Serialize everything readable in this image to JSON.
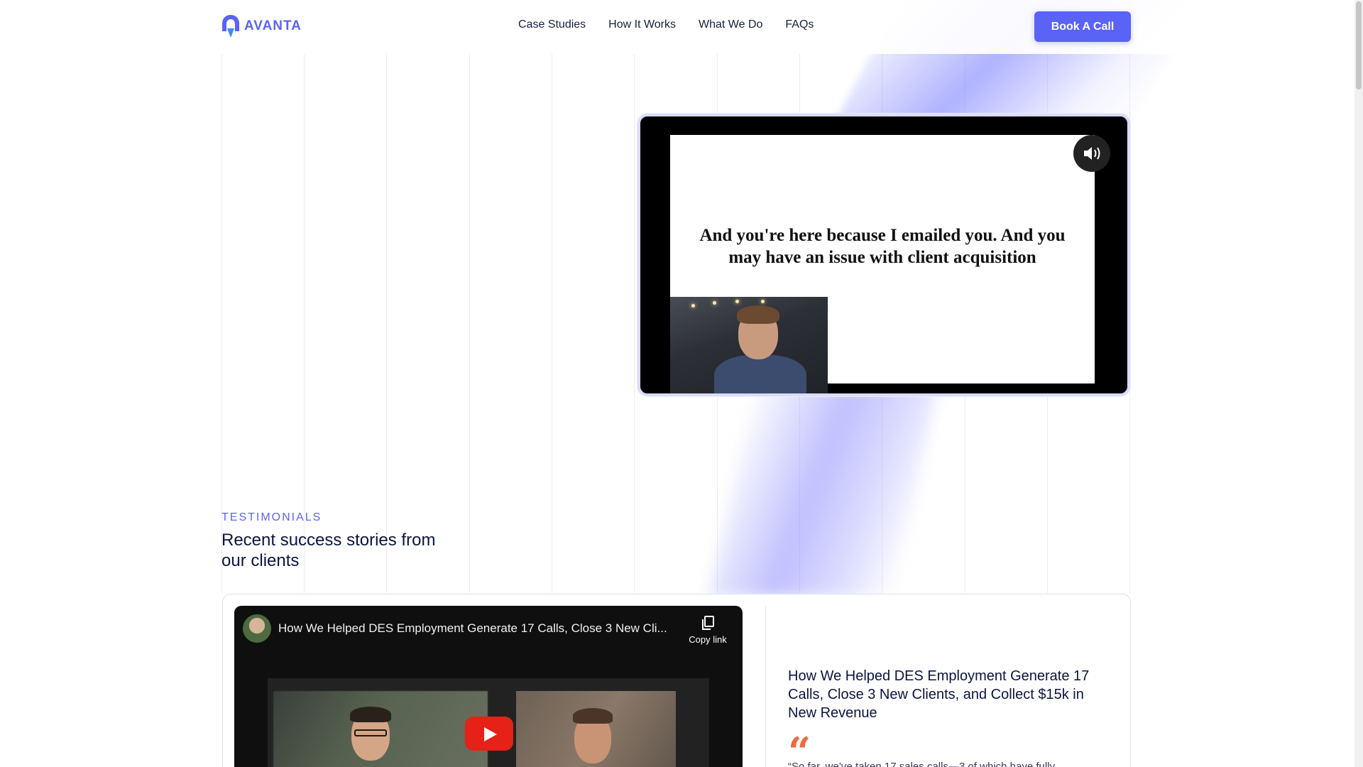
{
  "brand": {
    "logo_text": "AVANTA",
    "accent": "#5a63f6",
    "quote_color": "#f0693c"
  },
  "nav": {
    "items": [
      {
        "label": "Case Studies"
      },
      {
        "label": "How It Works"
      },
      {
        "label": "What We Do"
      },
      {
        "label": "FAQs"
      }
    ],
    "cta_label": "Book A Call"
  },
  "hero_video": {
    "caption": "And you're here because I emailed you. And you may have an issue with client acquisition",
    "sound_icon": "speaker-volume-icon"
  },
  "testimonials": {
    "eyebrow": "TESTIMONIALS",
    "heading": "Recent success stories from our clients",
    "card": {
      "video_title": "How We Helped DES Employment Generate 17 Calls, Close 3 New Cli...",
      "copy_link_label": "Copy link",
      "story_title": "How We Helped DES Employment Generate 17 Calls, Close 3 New Clients, and Collect $15k in New Revenue",
      "quote_mark": "“",
      "quote_excerpt": "“So far, we’ve taken 17 sales calls—3 of which have fully"
    }
  }
}
